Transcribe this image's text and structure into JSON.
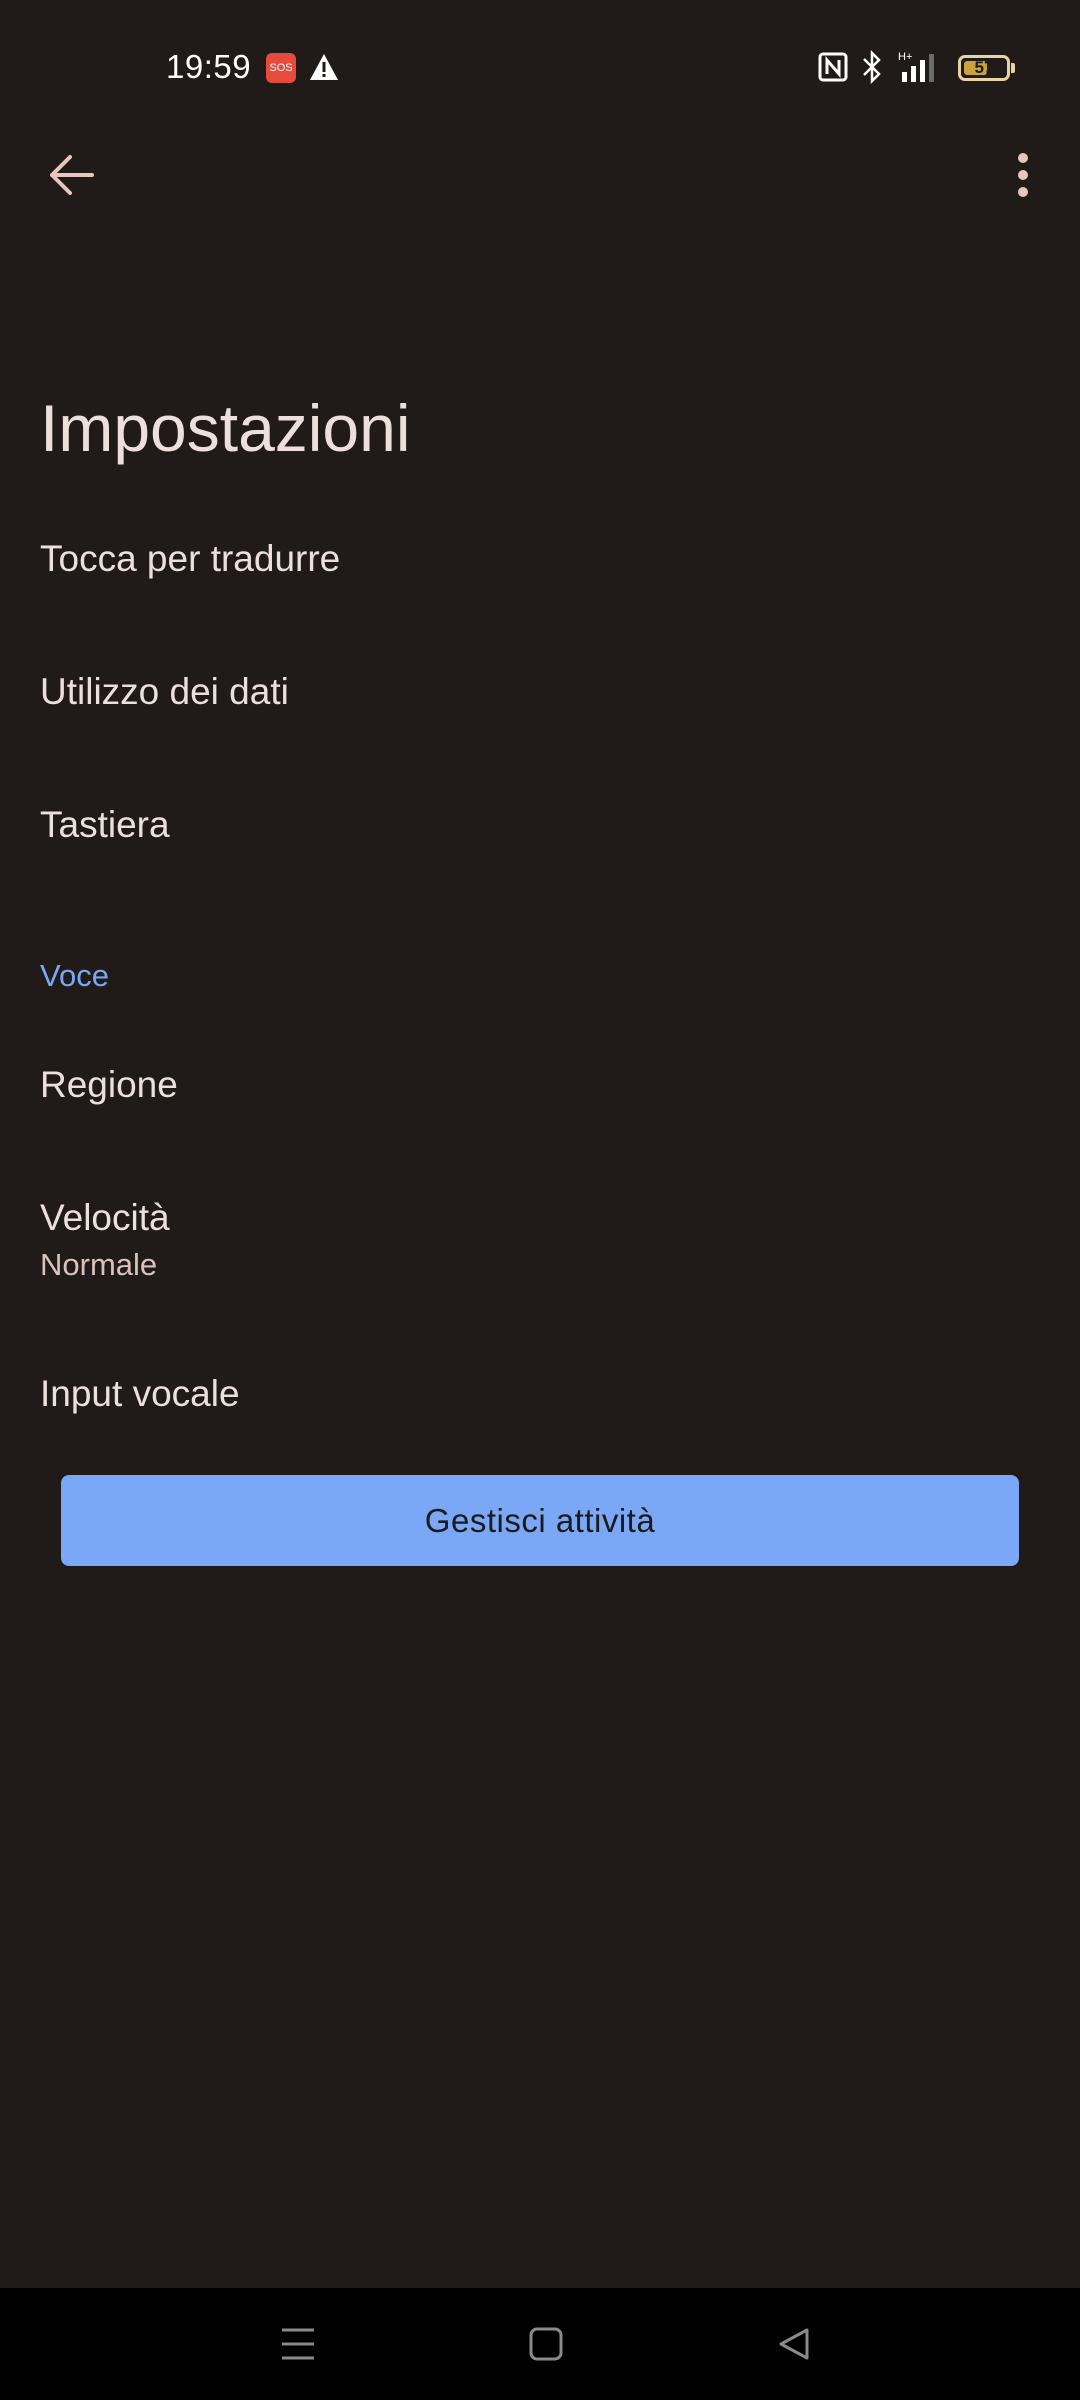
{
  "status_bar": {
    "time": "19:59",
    "sos_badge": "SOS",
    "battery_level": "57",
    "battery_fraction": 0.57
  },
  "toolbar": {
    "back_icon": "arrow-left-icon",
    "more_icon": "more-vert-icon"
  },
  "page": {
    "title": "Impostazioni"
  },
  "settings": {
    "items": [
      {
        "title": "Tocca per tradurre"
      },
      {
        "title": "Utilizzo dei dati"
      },
      {
        "title": "Tastiera"
      }
    ],
    "voice_section": {
      "header": "Voce",
      "items": [
        {
          "title": "Regione"
        },
        {
          "title": "Velocità",
          "summary": "Normale"
        },
        {
          "title": "Input vocale"
        }
      ]
    }
  },
  "actions": {
    "manage_activity_label": "Gestisci attività"
  },
  "colors": {
    "background": "#201b19",
    "accent": "#7ba8f6",
    "section_header": "#7aa7f5",
    "text_primary": "#ede0dc"
  }
}
